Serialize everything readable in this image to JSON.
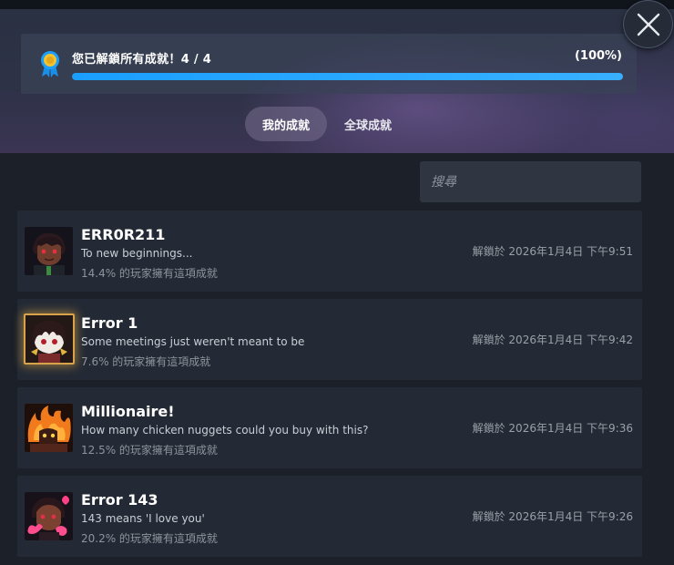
{
  "header": {
    "progress_text": "您已解鎖所有成就！4 / 4",
    "progress_percent": "(100%)",
    "progress_fraction": 1.0
  },
  "tabs": [
    {
      "label": "我的成就",
      "active": true
    },
    {
      "label": "全球成就",
      "active": false
    }
  ],
  "search": {
    "placeholder": "搜尋",
    "value": ""
  },
  "achievements": [
    {
      "title": "ERR0R211",
      "description": "To new beginnings...",
      "percent_text": "14.4% 的玩家擁有這項成就",
      "unlocked": "解鎖於 2026年1月4日 下午9:51",
      "icon": "character-portrait-icon"
    },
    {
      "title": "Error 1",
      "description": "Some meetings just weren't meant to be",
      "percent_text": "7.6% 的玩家擁有這項成就",
      "unlocked": "解鎖於 2026年1月4日 下午9:42",
      "icon": "rare-achievement-icon"
    },
    {
      "title": "Millionaire!",
      "description": "How many chicken nuggets could you buy with this?",
      "percent_text": "12.5% 的玩家擁有這項成就",
      "unlocked": "解鎖於 2026年1月4日 下午9:36",
      "icon": "fire-character-icon"
    },
    {
      "title": "Error 143",
      "description": "143 means 'I love you'",
      "percent_text": "20.2% 的玩家擁有這項成就",
      "unlocked": "解鎖於 2026年1月4日 下午9:26",
      "icon": "heart-character-icon"
    }
  ],
  "colors": {
    "accent": "#1a9fff",
    "row_bg": "#242a35",
    "gold_glow": "#d6a24a"
  }
}
